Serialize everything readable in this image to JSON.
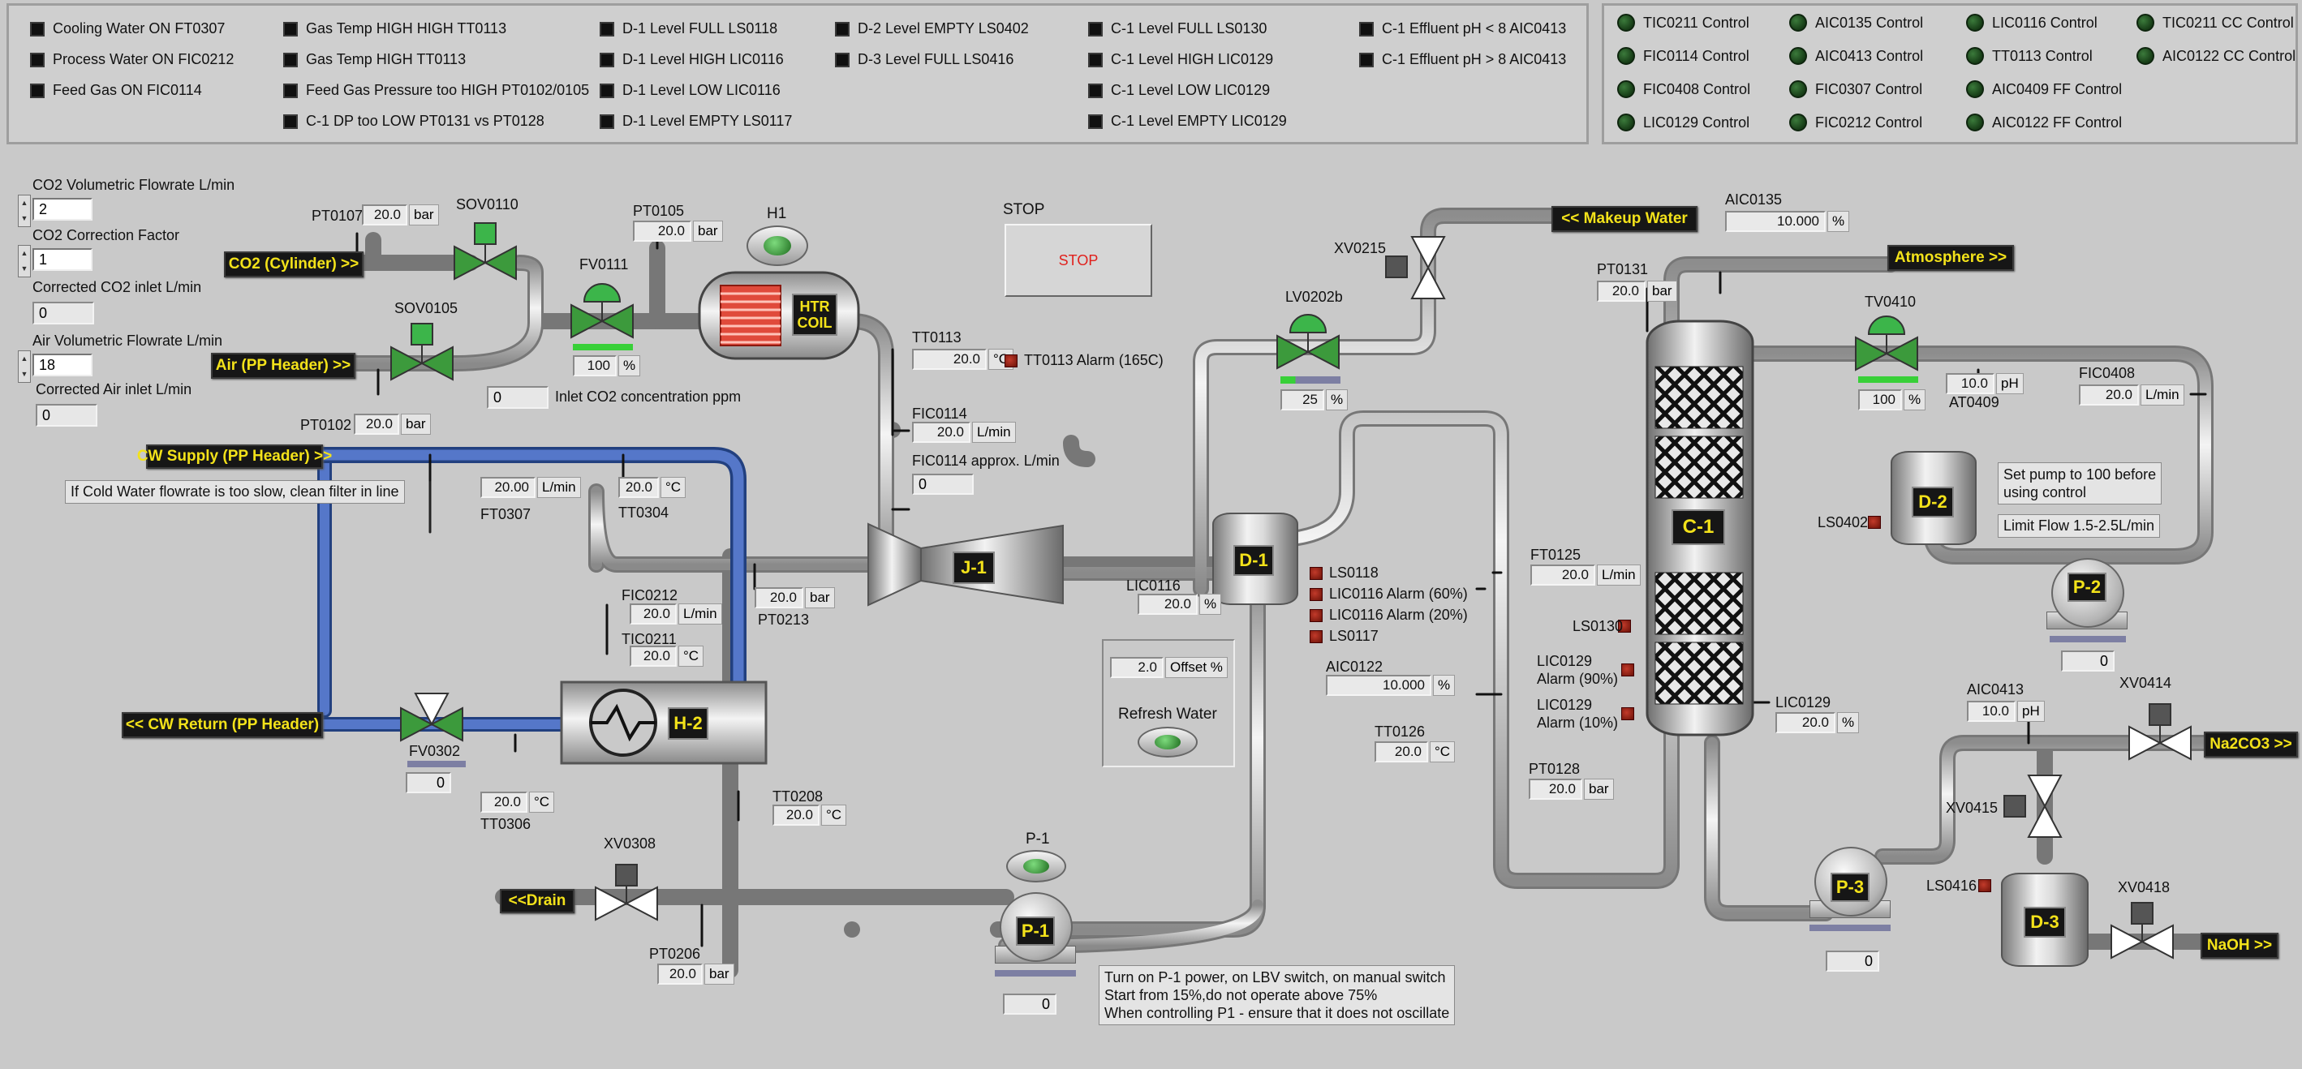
{
  "alarms_col1": [
    "Cooling Water ON FT0307",
    "Process Water ON FIC0212",
    "Feed Gas ON FIC0114"
  ],
  "alarms_col2": [
    "Gas Temp HIGH HIGH TT0113",
    "Gas Temp HIGH TT0113",
    "Feed Gas Pressure too HIGH PT0102/0105",
    "C-1 DP too LOW PT0131 vs PT0128"
  ],
  "alarms_col3": [
    "D-1 Level FULL LS0118",
    "D-1 Level HIGH LIC0116",
    "D-1 Level LOW LIC0116",
    "D-1 Level EMPTY LS0117"
  ],
  "alarms_col4": [
    "D-2 Level EMPTY LS0402",
    "D-3 Level FULL LS0416"
  ],
  "alarms_col5": [
    "C-1 Level FULL LS0130",
    "C-1 Level HIGH LIC0129",
    "C-1 Level LOW LIC0129",
    "C-1 Level EMPTY LIC0129"
  ],
  "alarms_col6": [
    "C-1 Effluent pH < 8 AIC0413",
    "C-1 Effluent pH > 8 AIC0413"
  ],
  "controls_col1": [
    "TIC0211 Control",
    "FIC0114 Control",
    "FIC0408 Control",
    "LIC0129 Control"
  ],
  "controls_col2": [
    "AIC0135 Control",
    "AIC0413 Control",
    "FIC0307 Control",
    "FIC0212 Control"
  ],
  "controls_col3": [
    "LIC0116 Control",
    "TT0113 Control",
    "AIC0409 FF Control",
    "AIC0122 FF Control"
  ],
  "controls_col4": [
    "TIC0211 CC Control",
    "AIC0122 CC Control"
  ],
  "inputs": {
    "co2_vol_label": "CO2 Volumetric Flowrate L/min",
    "co2_vol": "2",
    "co2_corr_label": "CO2 Correction Factor",
    "co2_corr": "1",
    "co2_corrected_label": "Corrected CO2  inlet L/min",
    "co2_corrected": "0",
    "air_vol_label": "Air Volumetric Flowrate L/min",
    "air_vol": "18",
    "air_corrected_label": "Corrected Air inlet L/min",
    "air_corrected": "0",
    "inlet_co2": "0",
    "inlet_co2_label": "Inlet CO2 concentration ppm"
  },
  "tags": {
    "co2_cyl": "CO2 (Cylinder) >>",
    "air_pp": "Air (PP Header) >>",
    "cw_supply": "CW Supply  (PP Header) >>",
    "cw_return": "<< CW Return (PP Header)",
    "drain": "<<Drain",
    "makeup": "<< Makeup Water",
    "atmosphere": "Atmosphere >>",
    "na2co3": "Na2CO3 >>",
    "naoh": "NaOH >>"
  },
  "instr": {
    "pt0107": {
      "name": "PT0107",
      "value": "20.0",
      "unit": "bar"
    },
    "pt0105": {
      "name": "PT0105",
      "value": "20.0",
      "unit": "bar"
    },
    "pt0102": {
      "name": "PT0102",
      "value": "20.0",
      "unit": "bar"
    },
    "ft0307": {
      "name": "FT0307",
      "value": "20.00",
      "unit": "L/min"
    },
    "tt0304": {
      "name": "TT0304",
      "value": "20.0",
      "unit": "°C"
    },
    "fic0212": {
      "name": "FIC0212",
      "value": "20.0",
      "unit": "L/min"
    },
    "tic0211": {
      "name": "TIC0211",
      "value": "20.0",
      "unit": "°C"
    },
    "pt0213": {
      "name": "PT0213",
      "value": "20.0",
      "unit": "bar"
    },
    "tt0113": {
      "name": "TT0113",
      "value": "20.0",
      "unit": "°C"
    },
    "fic0114": {
      "name": "FIC0114",
      "value": "20.0",
      "unit": "L/min"
    },
    "tt0306": {
      "name": "TT0306",
      "value": "20.0",
      "unit": "°C"
    },
    "tt0208": {
      "name": "TT0208",
      "value": "20.0",
      "unit": "°C"
    },
    "pt0206": {
      "name": "PT0206",
      "value": "20.0",
      "unit": "bar"
    },
    "lic0116": {
      "name": "LIC0116",
      "value": "20.0",
      "unit": "%"
    },
    "aic0122": {
      "name": "AIC0122",
      "value": "10.000",
      "unit": "%"
    },
    "tt0126": {
      "name": "TT0126",
      "value": "20.0",
      "unit": "°C"
    },
    "ft0125": {
      "name": "FT0125",
      "value": "20.0",
      "unit": "L/min"
    },
    "pt0128": {
      "name": "PT0128",
      "value": "20.0",
      "unit": "bar"
    },
    "pt0131": {
      "name": "PT0131",
      "value": "20.0",
      "unit": "bar"
    },
    "aic0135": {
      "name": "AIC0135",
      "value": "10.000",
      "unit": "%"
    },
    "lic0129": {
      "name": "LIC0129",
      "value": "20.0",
      "unit": "%"
    },
    "at0409": {
      "name": "AT0409",
      "value": "10.0",
      "unit": "pH"
    },
    "fic0408": {
      "name": "FIC0408",
      "value": "20.0",
      "unit": "L/min"
    },
    "aic0413": {
      "name": "AIC0413",
      "value": "10.0",
      "unit": "pH"
    }
  },
  "valves": {
    "sov0110": "SOV0110",
    "sov0105": "SOV0105",
    "fv0111": "FV0111",
    "fv0111_pct": "100",
    "fv0302": "FV0302",
    "fv0302_val": "0",
    "xv0308": "XV0308",
    "xv0215": "XV0215",
    "lv0202b": "LV0202b",
    "lv0202b_pct": "25",
    "tv0410": "TV0410",
    "tv0410_pct": "100",
    "xv0414": "XV0414",
    "xv0415": "XV0415",
    "xv0418": "XV0418",
    "pct_unit": "%"
  },
  "equip": {
    "h1": "H1",
    "htr": "HTR\nCOIL",
    "h2": "H-2",
    "j1": "J-1",
    "d1": "D-1",
    "d2": "D-2",
    "d3": "D-3",
    "c1": "C-1",
    "p1": "P-1",
    "p2": "P-2",
    "p3": "P-3",
    "p1_label": "P-1",
    "p1_val": "0",
    "p2_val": "0",
    "p3_val": "0"
  },
  "stop": {
    "caption": "STOP",
    "button": "STOP"
  },
  "alarm_tt0113": "TT0113 Alarm (165C)",
  "fic0114_approx_label": "FIC0114 approx. L/min",
  "fic0114_approx": "0",
  "d1_alarms": [
    "LS0118",
    "LIC0116 Alarm (60%)",
    "LIC0116 Alarm (20%)",
    "LS0117"
  ],
  "ls0130": "LS0130",
  "lic0129_90": "LIC0129\nAlarm (90%)",
  "lic0129_10": "LIC0129\nAlarm (10%)",
  "ls0402": "LS0402",
  "ls0416": "LS0416",
  "offset": {
    "value": "2.0",
    "unit": "Offset %"
  },
  "refresh": "Refresh Water",
  "cold_note": "If Cold Water flowrate is too slow, clean filter in line",
  "d2_note1": "Set pump to 100 before\nusing control",
  "d2_note2": "Limit Flow 1.5-2.5L/min",
  "p1_note": "Turn on P-1 power, on LBV switch, on manual switch\nStart from 15%,do not operate above 75%\nWhen controlling P1 - ensure that it does not oscillate",
  "colors": {
    "pipe": "#cfcfcf",
    "cw_pipe": "#3e62b6",
    "tag_bg": "#161616",
    "tag_fg": "#f3e21a",
    "valve_green": "#3c9a3c"
  }
}
